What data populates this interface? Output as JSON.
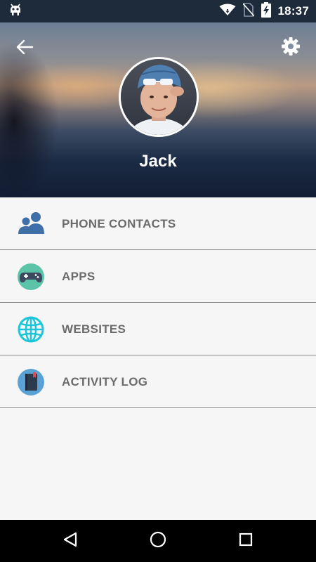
{
  "status_bar": {
    "time": "18:37",
    "icons": [
      "android-debug-icon",
      "wifi-icon",
      "no-sim-icon",
      "battery-charging-icon"
    ]
  },
  "header": {
    "back_icon": "arrow-left-icon",
    "settings_icon": "gear-icon",
    "profile_name": "Jack"
  },
  "menu": {
    "items": [
      {
        "label": "PHONE CONTACTS",
        "icon": "contacts-icon",
        "color": "#3f6fa8"
      },
      {
        "label": "APPS",
        "icon": "gamepad-icon",
        "color": "#5ac3a8"
      },
      {
        "label": "WEBSITES",
        "icon": "globe-icon",
        "color": "#1cc6d9"
      },
      {
        "label": "ACTIVITY LOG",
        "icon": "notebook-icon",
        "color": "#5aa2d6"
      }
    ]
  },
  "nav_bar": {
    "buttons": [
      "back-triangle-icon",
      "home-circle-icon",
      "recents-square-icon"
    ]
  }
}
